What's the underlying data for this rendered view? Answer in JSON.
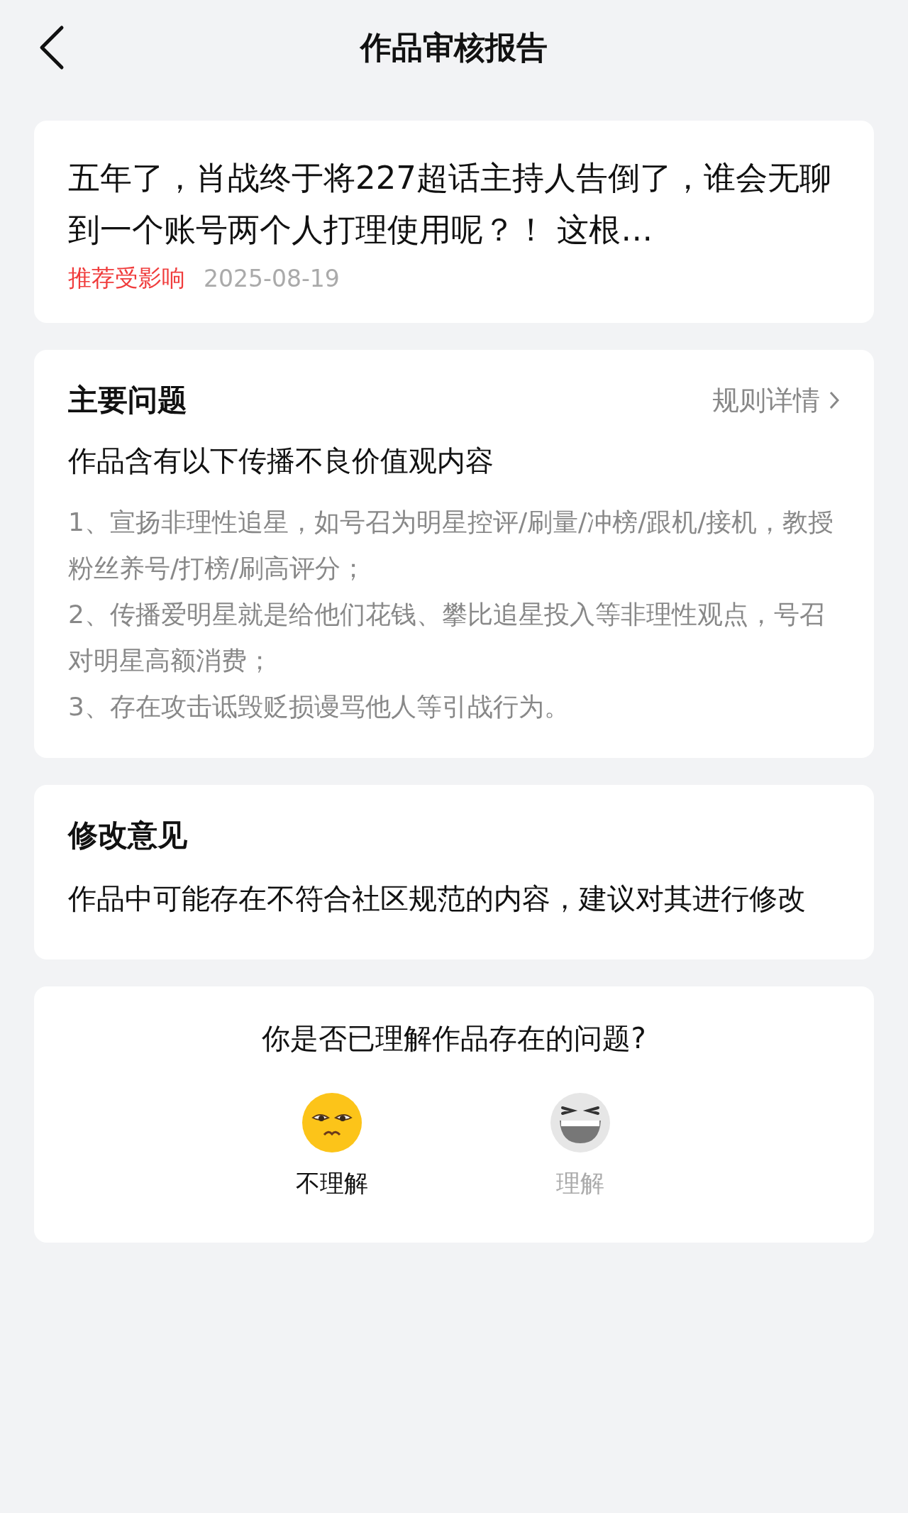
{
  "header": {
    "title": "作品审核报告"
  },
  "work": {
    "title": "五年了，肖战终于将227超话主持人告倒了，谁会无聊到一个账号两个人打理使用呢？！ 这根…",
    "tag": "推荐受影响",
    "date": "2025-08-19"
  },
  "issues": {
    "heading": "主要问题",
    "link": "规则详情",
    "summary": "作品含有以下传播不良价值观内容",
    "items": [
      "1、宣扬非理性追星，如号召为明星控评/刷量/冲榜/跟机/接机，教授粉丝养号/打榜/刷高评分；",
      "2、传播爱明星就是给他们花钱、攀比追星投入等非理性观点，号召对明星高额消费；",
      "3、存在攻击诋毁贬损谩骂他人等引战行为。"
    ]
  },
  "advice": {
    "heading": "修改意见",
    "text": "作品中可能存在不符合社区规范的内容，建议对其进行修改"
  },
  "feedback": {
    "question": "你是否已理解作品存在的问题?",
    "options": [
      {
        "label": "不理解",
        "kind": "frown",
        "selected": true
      },
      {
        "label": "理解",
        "kind": "laugh",
        "selected": false
      }
    ]
  }
}
